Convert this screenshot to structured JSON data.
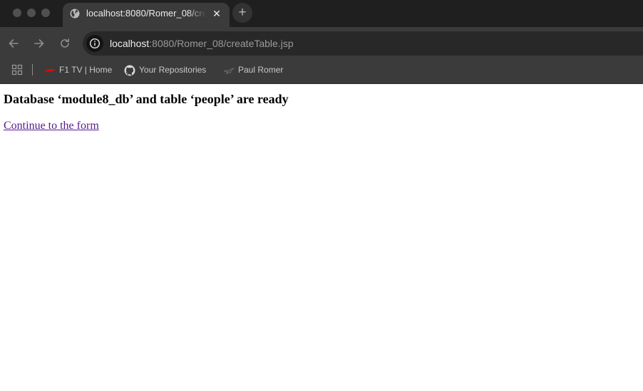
{
  "window": {
    "tab": {
      "title": "localhost:8080/Romer_08/createTable.jsp",
      "favicon": "globe-icon",
      "close_icon": "close-icon"
    },
    "new_tab_icon": "plus-icon"
  },
  "toolbar": {
    "back_icon": "arrow-left-icon",
    "forward_icon": "arrow-right-icon",
    "reload_icon": "reload-icon",
    "site_info_icon": "info-icon",
    "url_host": "localhost",
    "url_rest": ":8080/Romer_08/createTable.jsp"
  },
  "bookmarks": {
    "apps_icon": "apps-grid-icon",
    "items": [
      {
        "label": "F1 TV | Home",
        "icon": "f1-logo-icon"
      },
      {
        "label": "Your Repositories",
        "icon": "github-icon"
      },
      {
        "label": "Paul Romer",
        "icon": "bird-icon"
      }
    ]
  },
  "page": {
    "heading": "Database ‘module8_db’ and table ‘people’ are ready",
    "link_text": "Continue to the form"
  },
  "colors": {
    "titlebar": "#1f1f1f",
    "toolbar": "#3b3b3b",
    "omnibox": "#282828",
    "visited_link": "#551a8b",
    "f1_red": "#e10600"
  }
}
